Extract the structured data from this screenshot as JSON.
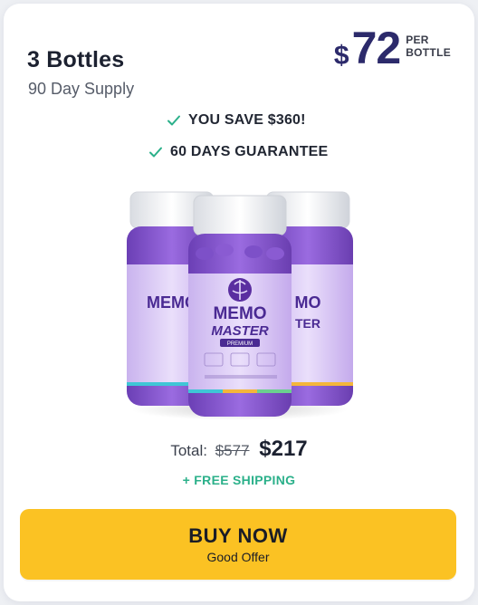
{
  "offer": {
    "title": "3 Bottles",
    "subtitle": "90 Day Supply",
    "currency": "$",
    "price": "72",
    "unit_line1": "PER",
    "unit_line2": "BOTTLE"
  },
  "benefits": [
    {
      "icon": "check-icon",
      "text": "YOU SAVE $360!"
    },
    {
      "icon": "check-icon",
      "text": "60 DAYS GUARANTEE"
    }
  ],
  "product": {
    "brand_line1": "MEMO",
    "brand_line2": "MASTER",
    "edition": "PREMIUM"
  },
  "pricing": {
    "label": "Total:",
    "old_price": "$577",
    "new_price": "$217",
    "shipping": "+ FREE SHIPPING"
  },
  "cta": {
    "label": "BUY NOW",
    "sublabel": "Good Offer"
  },
  "colors": {
    "accent": "#2c2a6b",
    "check": "#2bb08a",
    "button": "#fbc223",
    "label_purple": "#b79be6"
  }
}
